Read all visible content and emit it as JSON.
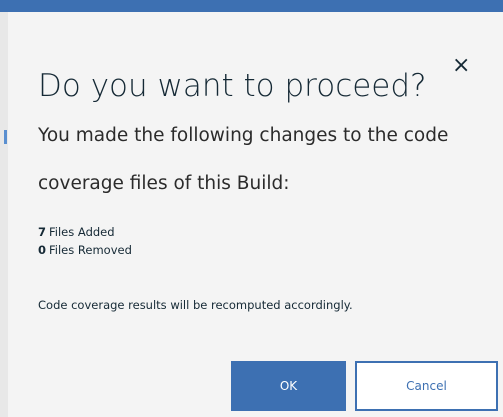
{
  "dialog": {
    "title": "Do you want to proceed?",
    "close_icon": "×",
    "subtitle": "You made the following changes to the code coverage files of this Build:",
    "files_added": {
      "count": "7",
      "label": "Files Added"
    },
    "files_removed": {
      "count": "0",
      "label": "Files Removed"
    },
    "note": "Code coverage results will be recomputed accordingly.",
    "ok_label": "OK",
    "cancel_label": "Cancel"
  },
  "colors": {
    "accent": "#3d70b2",
    "text": "#152935",
    "background": "#f4f4f4"
  }
}
